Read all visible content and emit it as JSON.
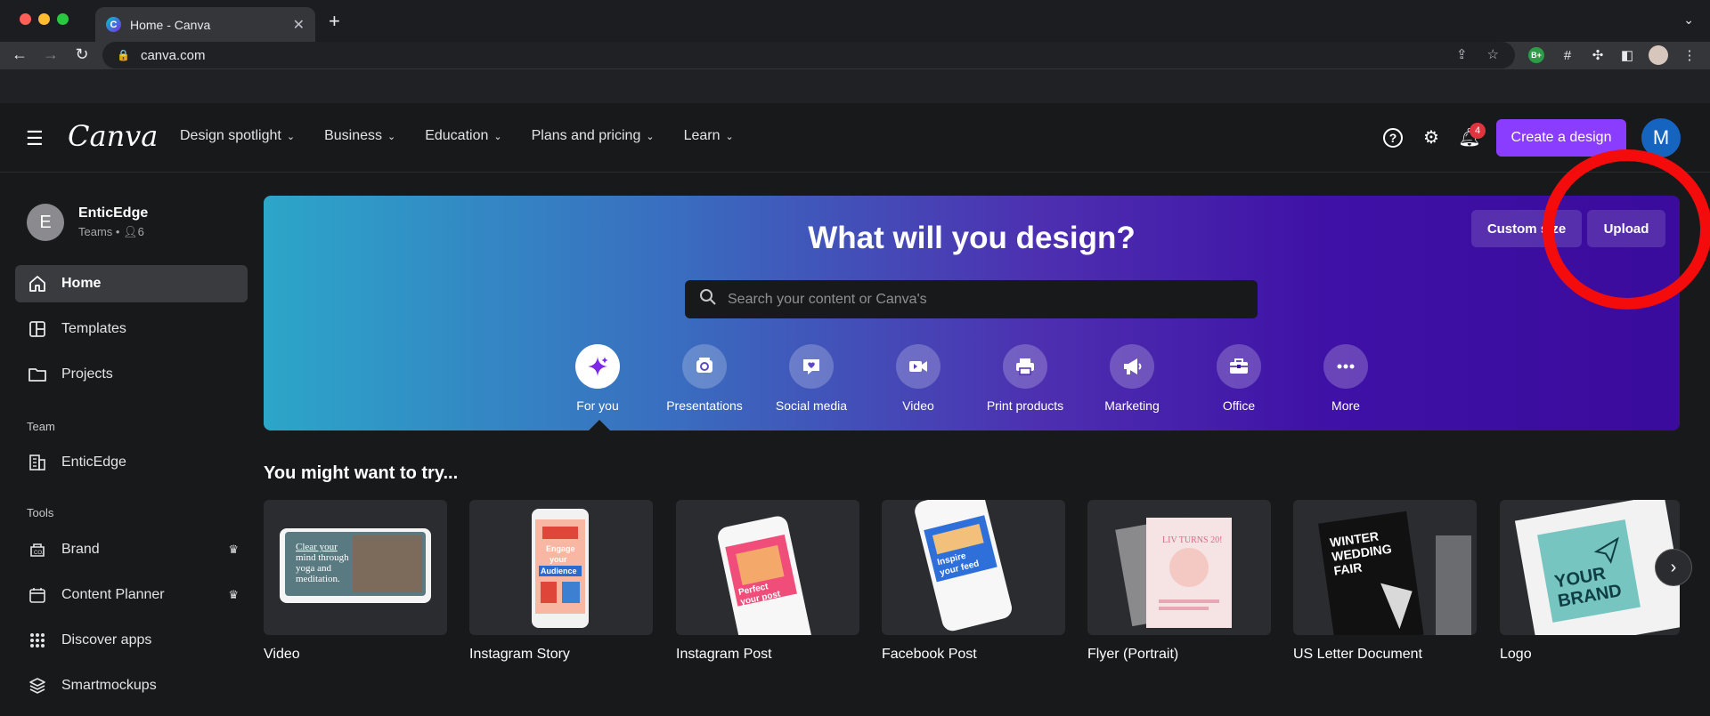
{
  "browser": {
    "tab_title": "Home - Canva",
    "url": "canva.com",
    "extension_badge": "B+"
  },
  "header": {
    "logo": "Canva",
    "nav": [
      {
        "label": "Design spotlight"
      },
      {
        "label": "Business"
      },
      {
        "label": "Education"
      },
      {
        "label": "Plans and pricing"
      },
      {
        "label": "Learn"
      }
    ],
    "help_icon": "?",
    "notification_count": "4",
    "create_button": "Create a design",
    "avatar_initial": "M"
  },
  "sidebar": {
    "team_initial": "E",
    "team_name": "EnticEdge",
    "team_type": "Teams",
    "member_count": "6",
    "items": [
      {
        "label": "Home",
        "icon": "home-icon"
      },
      {
        "label": "Templates",
        "icon": "templates-icon"
      },
      {
        "label": "Projects",
        "icon": "folder-icon"
      }
    ],
    "team_section": "Team",
    "team_items": [
      {
        "label": "EnticEdge",
        "icon": "building-icon"
      }
    ],
    "tools_section": "Tools",
    "tools_items": [
      {
        "label": "Brand",
        "icon": "brand-icon"
      },
      {
        "label": "Content Planner",
        "icon": "calendar-icon"
      },
      {
        "label": "Discover apps",
        "icon": "apps-grid-icon"
      },
      {
        "label": "Smartmockups",
        "icon": "layers-icon"
      }
    ]
  },
  "hero": {
    "title": "What will you design?",
    "custom_button": "Custom size",
    "upload_button": "Upload",
    "search_placeholder": "Search your content or Canva's",
    "categories": [
      {
        "label": "For you",
        "icon": "sparkle-icon"
      },
      {
        "label": "Presentations",
        "icon": "presentation-icon"
      },
      {
        "label": "Social media",
        "icon": "heart-chat-icon"
      },
      {
        "label": "Video",
        "icon": "video-icon"
      },
      {
        "label": "Print products",
        "icon": "printer-icon"
      },
      {
        "label": "Marketing",
        "icon": "megaphone-icon"
      },
      {
        "label": "Office",
        "icon": "briefcase-icon"
      },
      {
        "label": "More",
        "icon": "more-icon"
      }
    ]
  },
  "try_section": {
    "title": "You might want to try...",
    "cards": [
      {
        "label": "Video",
        "thumb_text": "Clear your mind through yoga and meditation."
      },
      {
        "label": "Instagram Story",
        "thumb_text": "Engage your Audience"
      },
      {
        "label": "Instagram Post",
        "thumb_text": "Perfect your post"
      },
      {
        "label": "Facebook Post",
        "thumb_text": "Inspire your feed"
      },
      {
        "label": "Flyer (Portrait)",
        "thumb_text": "LIV TURNS 20!"
      },
      {
        "label": "US Letter Document",
        "thumb_text": "WINTER WEDDING FAIR"
      },
      {
        "label": "Logo",
        "thumb_text": "YOUR BRAND"
      }
    ]
  },
  "colors": {
    "accent": "#8b3dff",
    "annotation": "#f40b0b",
    "notification": "#e2343f"
  }
}
